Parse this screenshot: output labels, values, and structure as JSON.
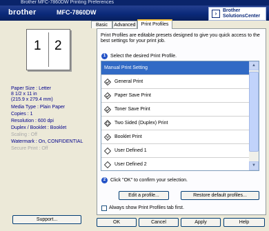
{
  "window": {
    "title_partial": "Brother MFC-7860DW Printing Preferences"
  },
  "header": {
    "brand": "brother",
    "model": "MFC-7860DW",
    "solutions_center_line1": "Brother",
    "solutions_center_line2": "SolutionsCenter"
  },
  "preview": {
    "page1": "1",
    "page2": "2"
  },
  "settings_summary": {
    "paper_size": "Paper Size : Letter",
    "paper_dims_in": "8 1/2 x 11 in",
    "paper_dims_mm": "(215.9 x 279.4 mm)",
    "media_type": "Media Type : Plain Paper",
    "copies": "Copies : 1",
    "resolution": "Resolution : 600 dpi",
    "duplex": "Duplex / Booklet : Booklet",
    "scaling": "Scaling : Off",
    "watermark": "Watermark : On, CONFIDENTIAL",
    "secure_print": "Secure Print : Off"
  },
  "support_button": {
    "label": "Support..."
  },
  "tabs": [
    {
      "label": "Basic"
    },
    {
      "label": "Advanced"
    },
    {
      "label": "Print Profiles"
    }
  ],
  "profiles_panel": {
    "description": "Print Profiles are editable presets designed to give you quick access to the best settings for your print job.",
    "step1_num": "1",
    "step1_text": "Select the desired Print Profile.",
    "items": [
      {
        "label": "Manual Print Setting",
        "icon": "none"
      },
      {
        "label": "General Print",
        "icon": "diamond-check-icon"
      },
      {
        "label": "Paper Save Print",
        "icon": "diamond-check-icon"
      },
      {
        "label": "Toner Save Print",
        "icon": "diamond-check-icon"
      },
      {
        "label": "Two Sided (Duplex) Print",
        "icon": "duplex-icon"
      },
      {
        "label": "Booklet Print",
        "icon": "booklet-icon"
      },
      {
        "label": "User Defined 1",
        "icon": "diamond-icon"
      },
      {
        "label": "User Defined 2",
        "icon": "diamond-icon"
      }
    ],
    "step2_num": "2",
    "step2_text": "Click \"OK\" to confirm your selection.",
    "edit_button": "Edit a profile...",
    "restore_button": "Restore default profiles...",
    "always_show_checkbox": {
      "label": "Always show Print Profiles tab first.",
      "checked": false
    }
  },
  "footer": {
    "ok": "OK",
    "cancel": "Cancel",
    "apply": "Apply",
    "help": "Help"
  },
  "colors": {
    "header": "#0b2a7a",
    "selection": "#316ac5",
    "summary_text": "#00008b",
    "dim_text": "#a8a8a8"
  }
}
